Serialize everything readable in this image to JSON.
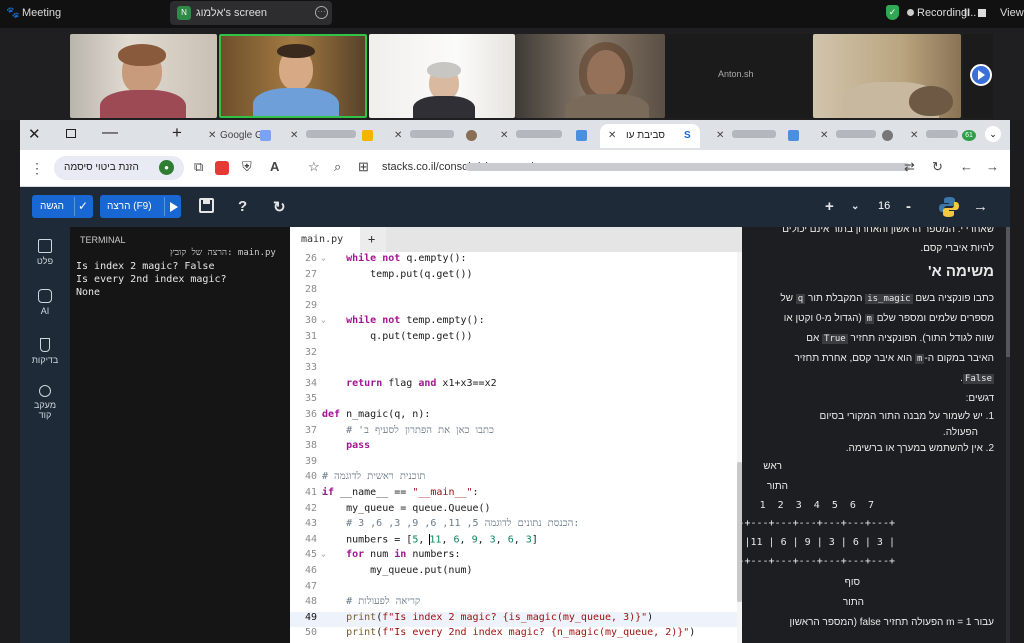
{
  "meeting": {
    "title": "Meeting",
    "screen_avatar": "N",
    "screen_label": "אלמוג's screen",
    "recording": "Recording...",
    "pause": "II",
    "view": "View"
  },
  "video_tiles": [
    {
      "name": ""
    },
    {
      "name": ""
    },
    {
      "name": ""
    },
    {
      "name": ""
    },
    {
      "name": "Anton.sh"
    },
    {
      "name": ""
    }
  ],
  "browser": {
    "tabs": [
      {
        "label": "Google G",
        "active": false
      },
      {
        "label": "",
        "active": false
      },
      {
        "label": "",
        "active": false
      },
      {
        "label": "",
        "active": false
      },
      {
        "label": "סביבת עו",
        "active": true
      },
      {
        "label": "",
        "active": false
      },
      {
        "label": "",
        "active": false
      },
      {
        "label": "",
        "active": false
      }
    ],
    "badge": "61",
    "profile_label": "הזנת ביטוי סיסמה",
    "url": "stacks.co.il/console/classroom/"
  },
  "toolbar": {
    "submit": "הגשה",
    "run": "הרצה (F9)",
    "help": "?",
    "page_number": "16",
    "plus": "+",
    "minus": "-"
  },
  "sidebar": {
    "items": [
      {
        "label": "פלט"
      },
      {
        "label": "AI"
      },
      {
        "label": "בדיקות"
      },
      {
        "label": "מעקב"
      },
      {
        "label": "קוד"
      }
    ]
  },
  "terminal": {
    "title": "TERMINAL",
    "run_caption": "הרצה של קובץ: main.py",
    "lines": [
      "Is index 2 magic? False",
      "Is every 2nd index magic?",
      "None"
    ]
  },
  "editor": {
    "file_tab": "main.py",
    "add_tab": "+",
    "lines": [
      {
        "n": "26",
        "fold": true,
        "code": "    while not q.empty():"
      },
      {
        "n": "27",
        "code": "        temp.put(q.get())"
      },
      {
        "n": "28",
        "code": ""
      },
      {
        "n": "29",
        "code": ""
      },
      {
        "n": "30",
        "fold": true,
        "code": "    while not temp.empty():"
      },
      {
        "n": "31",
        "code": "        q.put(temp.get())"
      },
      {
        "n": "32",
        "code": ""
      },
      {
        "n": "33",
        "code": ""
      },
      {
        "n": "34",
        "code": "    return flag and x1+x3==x2"
      },
      {
        "n": "35",
        "code": ""
      },
      {
        "n": "36",
        "fold": true,
        "code": "def n_magic(q, n):"
      },
      {
        "n": "37",
        "code": "    # 'כתבו כאן את הפתרון לסעיף ב"
      },
      {
        "n": "38",
        "code": "    pass"
      },
      {
        "n": "39",
        "code": ""
      },
      {
        "n": "40",
        "code": "# תוכנית ראשית לדוגמה"
      },
      {
        "n": "41",
        "fold": true,
        "code": "if __name__ == \"__main__\":"
      },
      {
        "n": "42",
        "code": "    my_queue = queue.Queue()"
      },
      {
        "n": "43",
        "code": "    # 3 ,6 ,3 ,9 ,6 ,11 ,5 הכנסת נתונים לדוגמה:"
      },
      {
        "n": "44",
        "code": "    numbers = [5, 11, 6, 9, 3, 6, 3]"
      },
      {
        "n": "45",
        "fold": true,
        "code": "    for num in numbers:"
      },
      {
        "n": "46",
        "code": "        my_queue.put(num)"
      },
      {
        "n": "47",
        "code": ""
      },
      {
        "n": "48",
        "code": "    # קריאה לפעולות"
      },
      {
        "n": "49",
        "code": "    print(f\"Is index 2 magic? {is_magic(my_queue, 3)}\")",
        "active": true
      },
      {
        "n": "50",
        "code": "    print(f\"Is every 2nd index magic? {n_magic(my_queue, 2)}\")"
      }
    ]
  },
  "instructions": {
    "line0": "שאחרי י. המספר הראשון והאחרון בתור אינם יכולים",
    "line1": "להיות איברי קסם.",
    "heading": "משימה א'",
    "p1a": "כתבו פונקציה בשם",
    "p1_code": "is_magic",
    "p1b": "המקבלת תור",
    "p1_q": "q",
    "p1c": "של",
    "p2a": "מספרים שלמים ומספר שלם",
    "p2_m": "m",
    "p2b": "(הגדול מ-0 וקטן או",
    "p3a": "שווה לגודל התור). הפונקציה תחזיר",
    "p3_true": "True",
    "p3b": "אם",
    "p4a": "האיבר במקום ה-",
    "p4_m": "m",
    "p4b": "הוא איבר קסם, אחרת תחזיר",
    "p5_false": "False",
    "notes_title": "דגשים:",
    "note1a": "1.  יש לשמור על מבנה התור המקורי בסיום",
    "note1b": "הפעולה.",
    "note2": "2.  אין להשתמש במערך או ברשימה.",
    "head_label": "ראש",
    "queue_label": "התור",
    "indices": "1  2  3  4  5  6  7",
    "sep1": "+---+---+---+---+---+---+---+",
    "values_row": "| 5 |11 | 6 | 9 | 3 | 6 | 3 |",
    "sep2": "+---+---+---+---+---+---+---+",
    "end_label": "סוף",
    "end_queue_label": "התור",
    "last": "עבור m = 1 הפעולה תחזיר false (המספר הראשון"
  },
  "colors": {
    "accent": "#1967d2",
    "app_bg": "#1e2a38",
    "active_speaker": "#33c14a"
  }
}
